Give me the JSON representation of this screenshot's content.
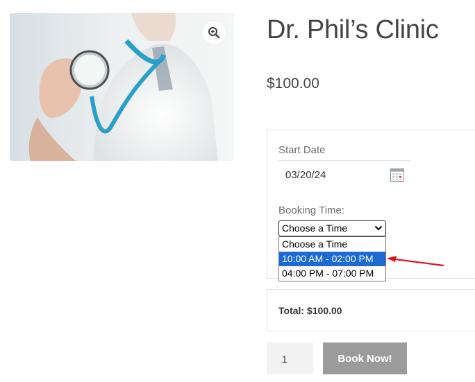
{
  "product": {
    "title": "Dr. Phil’s Clinic",
    "price": "$100.00"
  },
  "icons": {
    "zoom": "zoom-in-icon",
    "calendar": "calendar-icon",
    "dropdown": "chevron-down-icon"
  },
  "booking_form": {
    "start_date_label": "Start Date",
    "start_date_value": "03/20/24",
    "booking_time_label": "Booking Time:",
    "selected_value": "Choose a Time",
    "options": [
      "Choose a Time",
      "10:00 AM - 02:00 PM",
      "04:00 PM - 07:00 PM"
    ],
    "highlighted_option": "10:00 AM - 02:00 PM"
  },
  "total": "Total: $100.00",
  "cart": {
    "quantity": "1",
    "book_label": "Book Now!"
  },
  "colors": {
    "highlight": "#1d6ad3",
    "annotation_arrow": "#e0161c",
    "button": "#9b9b9b"
  }
}
